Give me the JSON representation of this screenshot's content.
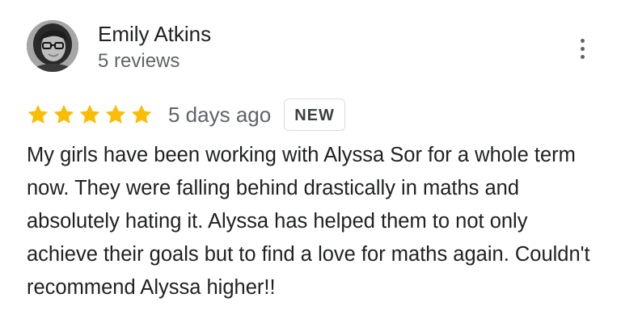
{
  "review": {
    "author": {
      "name": "Emily Atkins",
      "review_count": "5 reviews",
      "avatar_icon": "profile-photo"
    },
    "menu_icon": "more-vert-icon",
    "rating": {
      "stars": 5,
      "max_stars": 5,
      "star_color": "#fbbc04",
      "star_icon": "star-icon"
    },
    "date": "5 days ago",
    "badge": "NEW",
    "text": "My girls have been working with Alyssa Sor for a whole term now. They were falling behind drastically in maths and absolutely hating it. Alyssa has helped them to not only achieve their goals but to find a love for maths again. Couldn't recommend Alyssa higher!!"
  },
  "colors": {
    "primary_text": "#202124",
    "secondary_text": "#5f6368",
    "badge_border": "#dadce0"
  }
}
